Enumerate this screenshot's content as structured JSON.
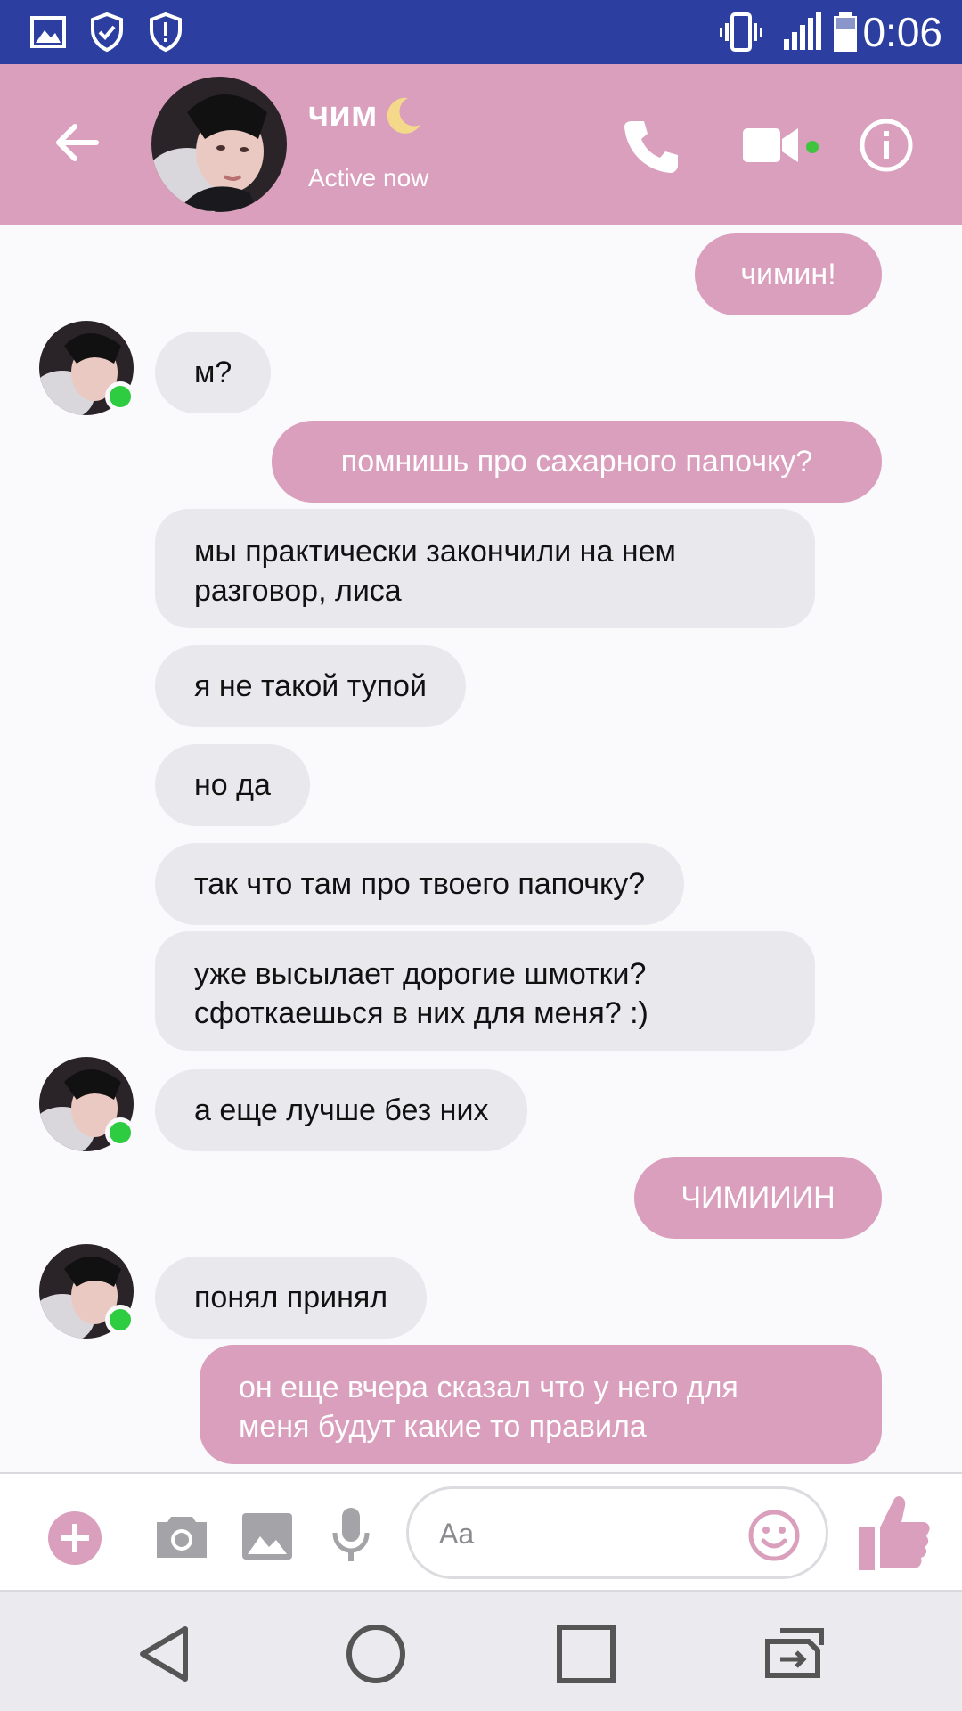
{
  "status_bar": {
    "time": "0:06",
    "icons": [
      "gallery-icon",
      "shield-check-icon",
      "shield-alert-icon",
      "vibrate-icon",
      "signal-icon",
      "battery-icon"
    ]
  },
  "header": {
    "contact_name": "чим",
    "contact_status": "Active now",
    "accent": "#d99fbd"
  },
  "messages": [
    {
      "side": "out",
      "text": "чимин!"
    },
    {
      "side": "in",
      "text": "м?"
    },
    {
      "side": "out",
      "text": "помнишь про сахарного папочку?"
    },
    {
      "side": "in",
      "lines": [
        "мы практически закончили на нем",
        "разговор, лиса"
      ]
    },
    {
      "side": "in",
      "text": "я не такой тупой"
    },
    {
      "side": "in",
      "text": "но да"
    },
    {
      "side": "in",
      "text": "так что там про твоего папочку?"
    },
    {
      "side": "in",
      "lines": [
        "уже высылает дорогие шмотки?",
        "сфоткаешься в них для меня? :)"
      ]
    },
    {
      "side": "in",
      "text": "а еще лучше без них"
    },
    {
      "side": "out",
      "text": "ЧИМИИИН"
    },
    {
      "side": "in",
      "text": "понял принял"
    },
    {
      "side": "out",
      "lines": [
        "он еще вчера сказал что у него для",
        "меня будут какие то правила"
      ]
    }
  ],
  "composer": {
    "placeholder": "Aa",
    "icons": [
      "plus-icon",
      "camera-icon",
      "image-icon",
      "mic-icon",
      "emoji-icon",
      "thumbs-up-icon"
    ]
  },
  "colors": {
    "status_bar": "#2c3fa0",
    "bubble_out": "#d99fbd",
    "bubble_in": "#e9e8ed",
    "online": "#2ecc40"
  }
}
